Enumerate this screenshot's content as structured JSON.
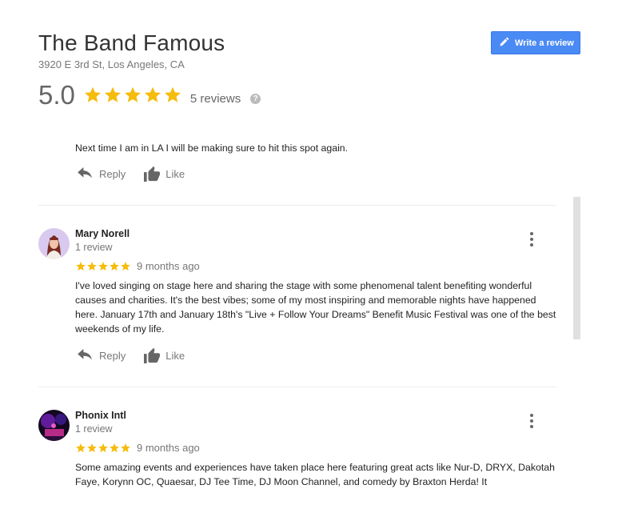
{
  "place": {
    "name": "The Band Famous",
    "address": "3920 E 3rd St, Los Angeles, CA"
  },
  "write_review": {
    "label": "Write a review"
  },
  "summary": {
    "rating": "5.0",
    "stars": 5,
    "review_count": "5 reviews",
    "help_glyph": "?"
  },
  "actions": {
    "reply": "Reply",
    "like": "Like"
  },
  "reviews": [
    {
      "text": "Next time I am in LA I will be making sure to hit this spot again."
    },
    {
      "name": "Mary Norell",
      "count": "1 review",
      "stars": 5,
      "time": "9 months ago",
      "text": "I've loved singing on stage here and sharing the stage with some phenomenal talent benefiting wonderful causes and charities. It's the best vibes; some of my most inspiring and memorable nights have happened here. January 17th and January 18th's \"Live + Follow Your Dreams\" Benefit Music Festival was one of the best weekends of my life."
    },
    {
      "name": "Phonix Intl",
      "count": "1 review",
      "stars": 5,
      "time": "9 months ago",
      "text": "Some amazing events and experiences have taken place here featuring great acts like Nur-D, DRYX, Dakotah Faye, Korynn OC, Quaesar, DJ Tee Time, DJ Moon Channel, and comedy by Braxton Herda! It"
    }
  ],
  "colors": {
    "star": "#f6bc0c",
    "button": "#4a8af4",
    "muted_text": "#777777"
  },
  "icons": {
    "write": "pencil-icon",
    "star": "star-icon",
    "help": "question-icon",
    "reply": "reply-arrow-icon",
    "like": "thumbs-up-icon",
    "more": "more-vertical-icon"
  }
}
